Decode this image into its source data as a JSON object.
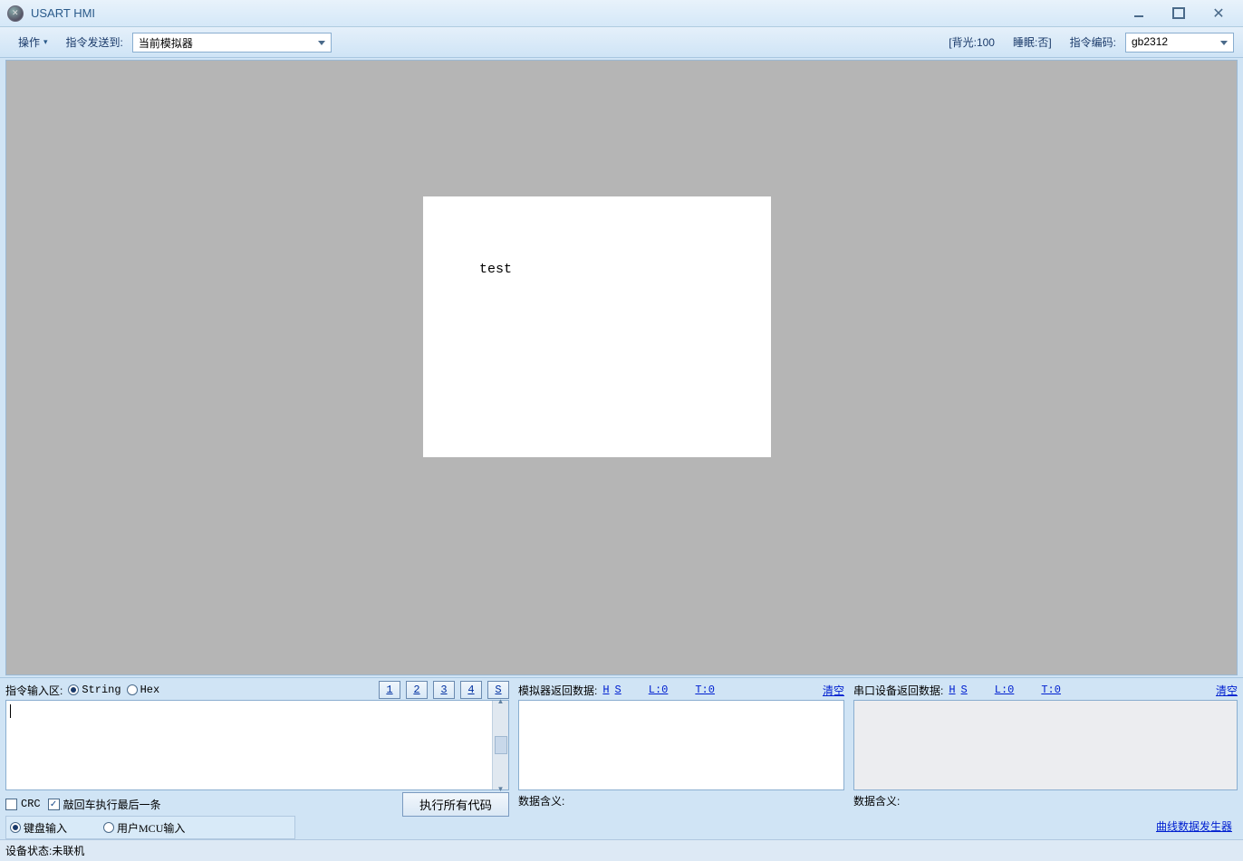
{
  "window": {
    "title": "USART HMI"
  },
  "toolbar": {
    "operate_label": "操作",
    "send_to_label": "指令发送到:",
    "send_to_value": "当前模拟器",
    "backlight_label": "[背光:100",
    "sleep_label": "睡眠:否]",
    "encoding_label": "指令编码:",
    "encoding_value": "gb2312"
  },
  "simulator": {
    "text": "test"
  },
  "input_panel": {
    "label": "指令输入区:",
    "radio_string": "String",
    "radio_hex": "Hex",
    "btns": [
      "1",
      "2",
      "3",
      "4",
      "S"
    ],
    "crc_label": "CRC",
    "enter_exec_label": "敲回车执行最后一条",
    "exec_all_label": "执行所有代码",
    "radio_kb": "键盘输入",
    "radio_mcu": "用户MCU输入"
  },
  "sim_return": {
    "label": "模拟器返回数据:",
    "h": "H",
    "s": "S",
    "l": "L:0",
    "t": "T:0",
    "clear": "清空",
    "meaning_label": "数据含义:"
  },
  "dev_return": {
    "label": "串口设备返回数据:",
    "h": "H",
    "s": "S",
    "l": "L:0",
    "t": "T:0",
    "clear": "清空",
    "meaning_label": "数据含义:"
  },
  "curve_link": "曲线数据发生器",
  "status": {
    "label": "设备状态:",
    "value": "未联机"
  }
}
